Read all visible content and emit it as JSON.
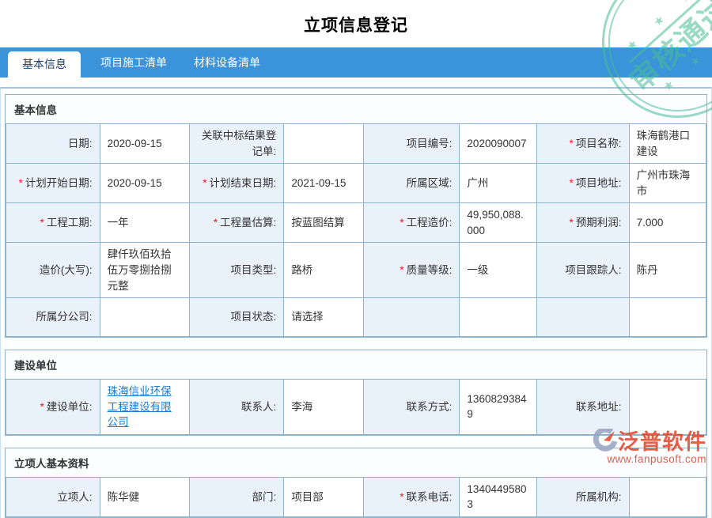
{
  "page_title": "立项信息登记",
  "stamp": {
    "text": "审核通过",
    "stars": "★ ★ ★",
    "color": "#48bd95"
  },
  "tabs": [
    {
      "label": "基本信息",
      "active": true
    },
    {
      "label": "项目施工清单",
      "active": false
    },
    {
      "label": "材料设备清单",
      "active": false
    }
  ],
  "colors": {
    "tab_bar": "#3b93da",
    "label_cell": "#e9f2fb",
    "border": "#8fb3ca",
    "link": "#1d7ad0",
    "required_mark": "#e02020",
    "watermark": "#e2492f"
  },
  "watermark": {
    "name": "泛普软件",
    "url": "www.fanpusoft.com"
  },
  "sections": [
    {
      "title": "基本信息",
      "rows": [
        {
          "cells": [
            {
              "req": "",
              "label": "日期:"
            },
            {
              "value": "2020-09-15"
            },
            {
              "req": "",
              "label": "关联中标结果登记单:"
            },
            {
              "value": ""
            },
            {
              "req": "",
              "label": "项目编号:"
            },
            {
              "value": "2020090007"
            },
            {
              "req": "*",
              "label": "项目名称:"
            },
            {
              "value": "珠海鹤港口建设"
            }
          ]
        },
        {
          "cells": [
            {
              "req": "*",
              "label": "计划开始日期:"
            },
            {
              "value": "2020-09-15"
            },
            {
              "req": "*",
              "label": "计划结束日期:"
            },
            {
              "value": "2021-09-15"
            },
            {
              "req": "",
              "label": "所属区域:"
            },
            {
              "value": "广州"
            },
            {
              "req": "*",
              "label": "项目地址:"
            },
            {
              "value": "广州市珠海市"
            }
          ]
        },
        {
          "cells": [
            {
              "req": "*",
              "label": "工程工期:"
            },
            {
              "value": "一年"
            },
            {
              "req": "*",
              "label": "工程量估算:"
            },
            {
              "value": "按蓝图结算"
            },
            {
              "req": "*",
              "label": "工程造价:"
            },
            {
              "value": "49,950,088.000"
            },
            {
              "req": "*",
              "label": "预期利润:"
            },
            {
              "value": "7.000"
            }
          ]
        },
        {
          "cells": [
            {
              "req": "",
              "label": "造价(大写):"
            },
            {
              "value": "肆仟玖佰玖拾伍万零捌拾捌元整"
            },
            {
              "req": "",
              "label": "项目类型:"
            },
            {
              "value": "路桥"
            },
            {
              "req": "*",
              "label": "质量等级:"
            },
            {
              "value": "一级"
            },
            {
              "req": "",
              "label": "项目跟踪人:"
            },
            {
              "value": "陈丹"
            }
          ]
        },
        {
          "cells": [
            {
              "req": "",
              "label": "所属分公司:"
            },
            {
              "value": ""
            },
            {
              "req": "",
              "label": "项目状态:"
            },
            {
              "value": "请选择"
            },
            {
              "req": "",
              "label": ""
            },
            {
              "value": ""
            },
            {
              "req": "",
              "label": ""
            },
            {
              "value": ""
            }
          ]
        }
      ]
    },
    {
      "title": "建设单位",
      "rows": [
        {
          "cells": [
            {
              "req": "*",
              "label": "建设单位:"
            },
            {
              "value": "珠海信业环保工程建设有限公司",
              "link": true
            },
            {
              "req": "",
              "label": "联系人:"
            },
            {
              "value": "李海"
            },
            {
              "req": "",
              "label": "联系方式:"
            },
            {
              "value": "13608293849"
            },
            {
              "req": "",
              "label": "联系地址:"
            },
            {
              "value": ""
            }
          ]
        }
      ]
    },
    {
      "title": "立项人基本资料",
      "rows": [
        {
          "cells": [
            {
              "req": "",
              "label": "立项人:"
            },
            {
              "value": "陈华健"
            },
            {
              "req": "",
              "label": "部门:"
            },
            {
              "value": "项目部"
            },
            {
              "req": "*",
              "label": "联系电话:"
            },
            {
              "value": "13404495803"
            },
            {
              "req": "",
              "label": "所属机构:"
            },
            {
              "value": ""
            }
          ]
        }
      ]
    }
  ]
}
